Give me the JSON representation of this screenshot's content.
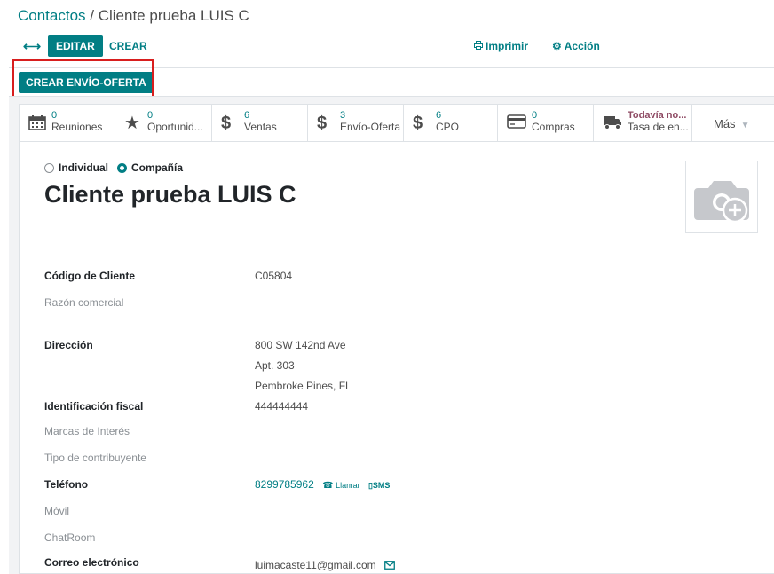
{
  "breadcrumb": {
    "parent": "Contactos",
    "separator": " / ",
    "current": "Cliente prueba LUIS C"
  },
  "toolbar": {
    "edit_label": "EDITAR",
    "create_label": "CREAR",
    "print_label": "Imprimir",
    "action_label": "Acción"
  },
  "statusbar": {
    "create_offer_label": "CREAR ENVÍO-OFERTA"
  },
  "smart_buttons": [
    {
      "value": "0",
      "label": "Reuniones",
      "icon": "calendar-icon"
    },
    {
      "value": "0",
      "label": "Oportunid...",
      "icon": "star-icon"
    },
    {
      "value": "6",
      "label": "Ventas",
      "icon": "dollar-icon"
    },
    {
      "value": "3",
      "label": "Envío-Oferta",
      "icon": "dollar-icon"
    },
    {
      "value": "6",
      "label": "CPO",
      "icon": "dollar-icon"
    },
    {
      "value": "0",
      "label": "Compras",
      "icon": "credit-card-icon"
    },
    {
      "value": "Todavía no...",
      "label": "Tasa de en...",
      "icon": "truck-icon"
    }
  ],
  "more_label": "Más",
  "partner_type": {
    "individual": "Individual",
    "company": "Compañía",
    "selected": "company"
  },
  "record": {
    "name": "Cliente prueba LUIS C"
  },
  "fields": {
    "customer_code": {
      "label": "Código de Cliente",
      "value": "C05804"
    },
    "trade_name": {
      "label": "Razón comercial"
    },
    "address": {
      "label": "Dirección",
      "street": "800 SW 142nd Ave",
      "street2": "Apt. 303",
      "city_state": "Pembroke Pines, FL"
    },
    "tax_id": {
      "label": "Identificación fiscal",
      "value": "444444444"
    },
    "brands": {
      "label": "Marcas de Interés"
    },
    "taxpayer_type": {
      "label": "Tipo de contribuyente"
    },
    "phone": {
      "label": "Teléfono",
      "value": "8299785962",
      "call_label": "Llamar",
      "sms_label": "SMS"
    },
    "mobile": {
      "label": "Móvil"
    },
    "chatroom": {
      "label": "ChatRoom"
    },
    "email": {
      "label": "Correo electrónico",
      "value": "luimacaste11@gmail.com"
    }
  },
  "colors": {
    "brand": "#017e84",
    "highlight": "#d81e1e"
  }
}
